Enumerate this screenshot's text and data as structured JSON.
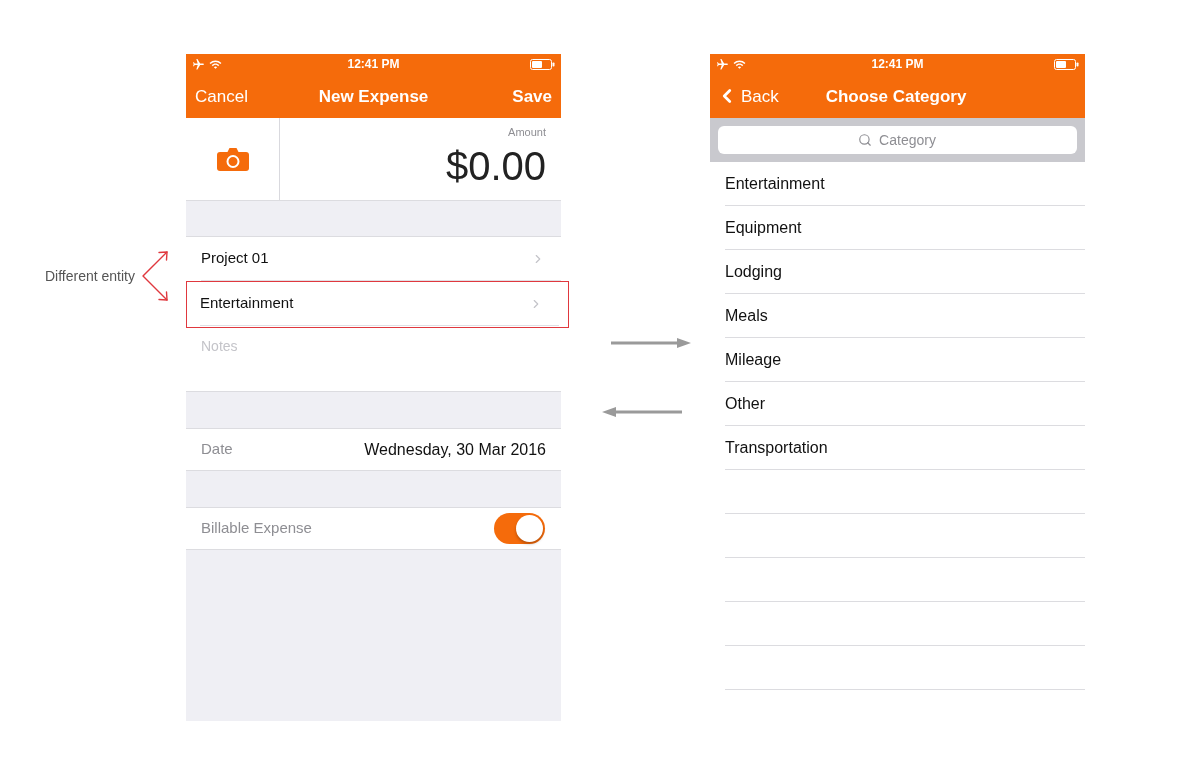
{
  "annotation": {
    "text": "Different entity"
  },
  "new_expense_screen": {
    "status_bar": {
      "time": "12:41 PM"
    },
    "nav_bar": {
      "left_button": "Cancel",
      "title": "New Expense",
      "right_button": "Save"
    },
    "amount": {
      "label": "Amount",
      "value": "$0.00"
    },
    "pickers": [
      {
        "label": "Project 01",
        "highlighted": false
      },
      {
        "label": "Entertainment",
        "highlighted": true
      }
    ],
    "notes": {
      "placeholder": "Notes"
    },
    "date": {
      "label": "Date",
      "value": "Wednesday, 30 Mar 2016"
    },
    "billable": {
      "label": "Billable Expense",
      "on": true
    }
  },
  "choose_category_screen": {
    "status_bar": {
      "time": "12:41 PM"
    },
    "nav_bar": {
      "back_button": "Back",
      "title": "Choose Category"
    },
    "search": {
      "placeholder": "Category"
    },
    "categories": [
      "Entertainment",
      "Equipment",
      "Lodging",
      "Meals",
      "Mileage",
      "Other",
      "Transportation"
    ]
  }
}
